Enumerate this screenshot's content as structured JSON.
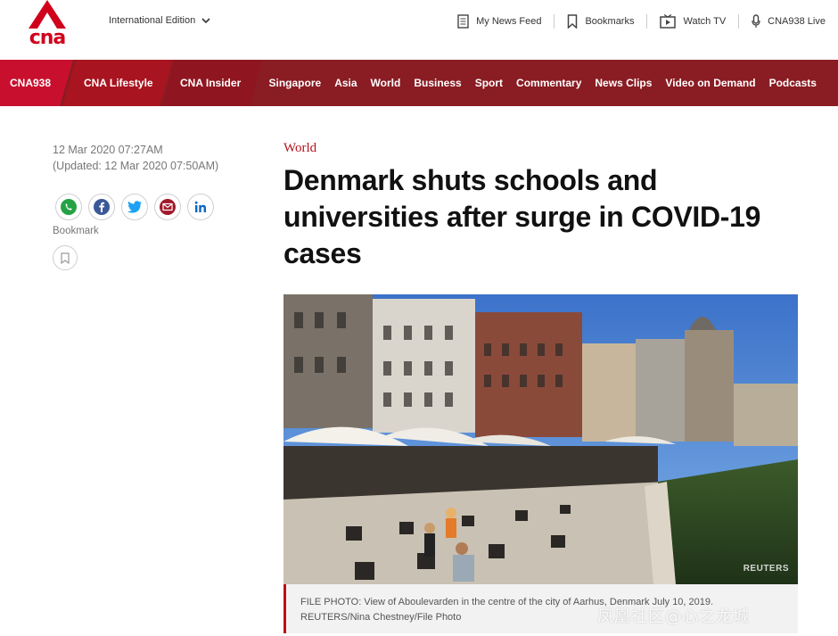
{
  "brand": {
    "logo_text": "cna",
    "accent": "#c8102e",
    "nav_bg": "#8a1c23"
  },
  "topbar": {
    "edition_label": "International Edition",
    "links": [
      {
        "label": "My News Feed",
        "icon": "news-feed-icon"
      },
      {
        "label": "Bookmarks",
        "icon": "bookmark-icon"
      },
      {
        "label": "Watch TV",
        "icon": "tv-icon"
      },
      {
        "label": "CNA938 Live",
        "icon": "microphone-icon"
      }
    ]
  },
  "nav": {
    "featured": [
      "CNA938",
      "CNA Lifestyle",
      "CNA Insider"
    ],
    "items": [
      "Singapore",
      "Asia",
      "World",
      "Business",
      "Sport",
      "Commentary",
      "News Clips",
      "Video on Demand",
      "Podcasts"
    ]
  },
  "article": {
    "published": "12 Mar 2020 07:27AM",
    "updated": "(Updated: 12 Mar 2020 07:50AM)",
    "category": "World",
    "headline": "Denmark shuts schools and universities after surge in COVID-19 cases",
    "share": [
      {
        "name": "whatsapp",
        "icon": "whatsapp-icon",
        "color": "#25a244"
      },
      {
        "name": "facebook",
        "icon": "facebook-icon",
        "color": "#3b5998"
      },
      {
        "name": "twitter",
        "icon": "twitter-icon",
        "color": "#1da1f2"
      },
      {
        "name": "email",
        "icon": "email-icon",
        "color": "#a01a2b"
      },
      {
        "name": "linkedin",
        "icon": "linkedin-icon",
        "color": "#0a66c2"
      }
    ],
    "bookmark_label": "Bookmark",
    "photo_credit_mark": "REUTERS",
    "caption_line1": "FILE PHOTO: View of Aboulevarden in the centre of the city of Aarhus, Denmark July 10, 2019.",
    "caption_line2": "REUTERS/Nina Chestney/File Photo"
  },
  "watermark": "凤凰社区@心之龙城"
}
